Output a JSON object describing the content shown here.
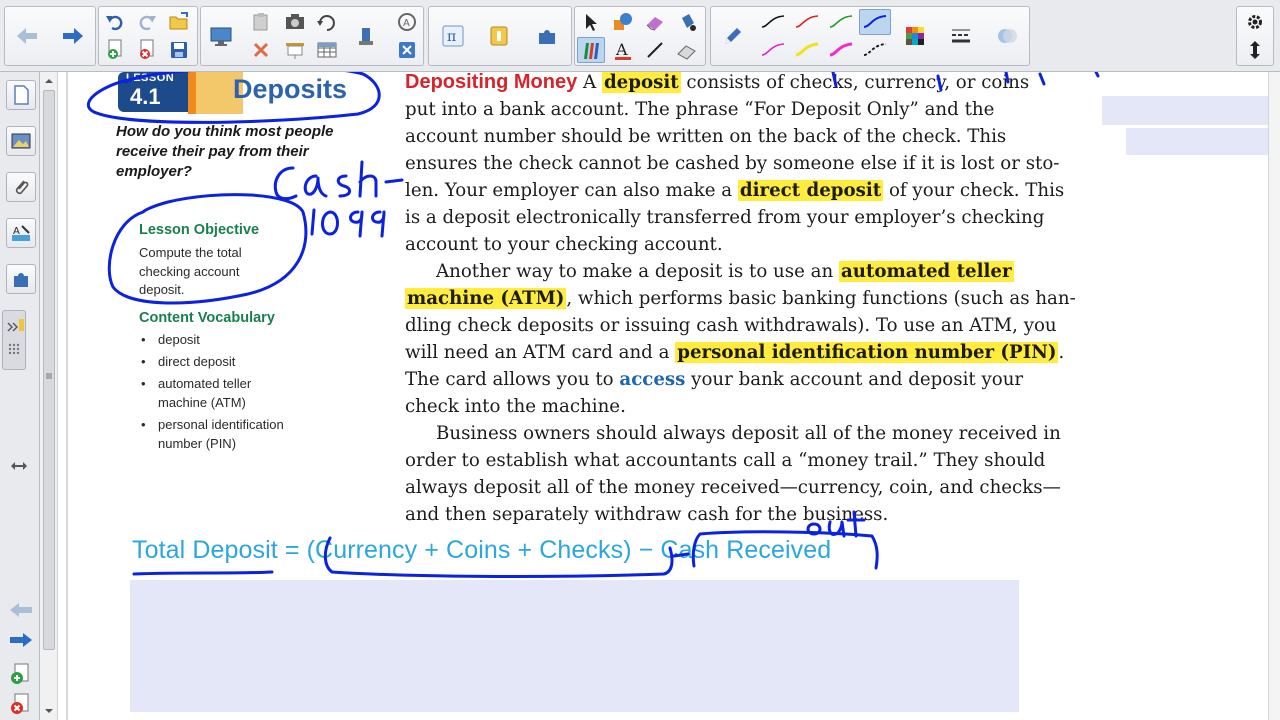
{
  "toolbar": {
    "groups": [
      "navigation",
      "page",
      "math",
      "draw",
      "pens",
      "properties"
    ],
    "icons": {
      "back": "left-arrow-icon",
      "forward": "right-arrow-icon",
      "undo": "undo-icon",
      "redo": "redo-icon",
      "open": "folder-icon",
      "add_page": "add-page-icon",
      "delete_page": "delete-page-icon",
      "save": "save-icon"
    }
  },
  "sidebar": {
    "icons": [
      "page-sorter-icon",
      "gallery-icon",
      "attachments-icon",
      "properties-icon",
      "addons-icon"
    ]
  },
  "lesson": {
    "badge_label": "LESSON",
    "badge_number": "4.1",
    "title": "Deposits",
    "question": "How do you think most people receive their pay from their employer?",
    "objective_title": "Lesson Objective",
    "objective_text": "Compute the total checking account deposit.",
    "vocab_title": "Content Vocabulary",
    "vocab_items": [
      "deposit",
      "direct deposit",
      "automated teller machine (ATM)",
      "personal identification number (PIN)"
    ]
  },
  "body": {
    "heading": "Depositing Money",
    "p1_a": " A ",
    "term_deposit": "deposit",
    "p1_b": " consists of checks, currency, or coins",
    "l2": "put into a bank account. The phrase “For Deposit Only” and the",
    "l3": "account number should be written on the back of the check. This",
    "l4": "ensures the check cannot be cashed by someone else if it is lost or sto-",
    "l5_a": "len. Your employer can also make a ",
    "term_direct": "direct deposit",
    "l5_b": " of your check. This",
    "l6": "is a deposit electronically transferred from your employer’s checking",
    "l7": "account to your checking account.",
    "l8_a": "Another way to make a deposit is to use an ",
    "term_atm_1": "automated teller",
    "term_atm_2": "machine (ATM)",
    "l9_b": ", which performs basic banking functions (such as han-",
    "l10": "dling check deposits or issuing cash withdrawals). To use an ATM, you",
    "l11_a": "will need an ATM card and a ",
    "term_pin": "personal identification number (PIN)",
    "l11_b": ".",
    "l12_a": "The card allows you to ",
    "term_access": "access",
    "l12_b": " your bank account and deposit your",
    "l13": "check into the machine.",
    "l14": "Business owners should always deposit all of the money received in",
    "l15": "order to establish what accountants call a “money trail.” They should",
    "l16": "always deposit all of the money received—currency, coin, and checks—",
    "l17": "and then separately withdraw cash for the business."
  },
  "formula": {
    "text": "Total Deposit = (Currency + Coins + Checks) − Cash Received"
  },
  "colors": {
    "ink": "#0b22e0",
    "highlight": "#ffec3d",
    "heading_red": "#d8232a",
    "formula_blue": "#2ba7dc",
    "green": "#1a7f4e",
    "mask": "#e4e7f8"
  }
}
